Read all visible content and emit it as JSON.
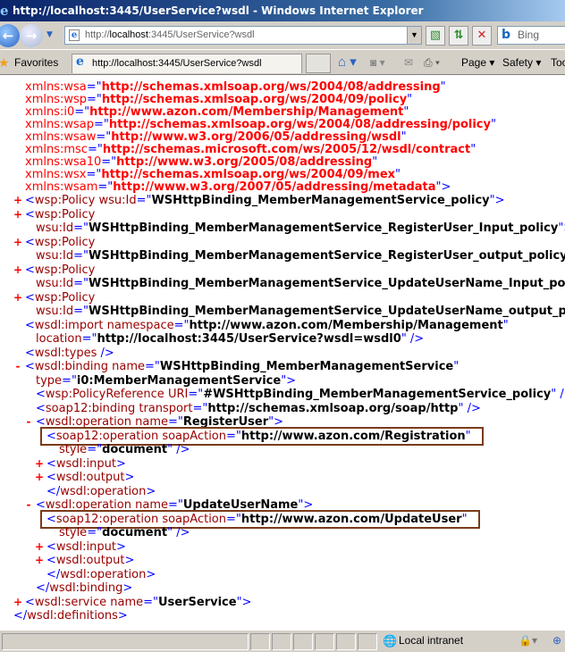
{
  "window": {
    "title": "http://localhost:3445/UserService?wsdl - Windows Internet Explorer"
  },
  "address": {
    "url_prefix": "http://",
    "url_host": "localhost",
    "url_rest": ":3445/UserService?wsdl",
    "search_placeholder": "Bing",
    "back": "←",
    "forward": "→"
  },
  "favorites": {
    "label": "Favorites",
    "tab_title": "http://localhost:3445/UserService?wsdl"
  },
  "commands": {
    "page": "Page ▾",
    "safety": "Safety ▾",
    "tools": "Tools"
  },
  "status": {
    "zone": "Local intranet"
  },
  "colors": {
    "tag": "#990000",
    "bracket": "#0000ff",
    "ns": "#ff0000",
    "box": "#7a3b1a"
  },
  "lines": [
    {
      "lv": 0,
      "tg": "",
      "parts": [
        [
          "na",
          "xmlns:wsa"
        ],
        [
          "q",
          "=\""
        ],
        [
          "nv",
          "http://schemas.xmlsoap.org/ws/2004/08/addressing"
        ],
        [
          "q",
          "\""
        ]
      ]
    },
    {
      "lv": 0,
      "tg": "",
      "parts": [
        [
          "na",
          "xmlns:wsp"
        ],
        [
          "q",
          "=\""
        ],
        [
          "nv",
          "http://schemas.xmlsoap.org/ws/2004/09/policy"
        ],
        [
          "q",
          "\""
        ]
      ]
    },
    {
      "lv": 0,
      "tg": "",
      "parts": [
        [
          "na",
          "xmlns:i0"
        ],
        [
          "q",
          "=\""
        ],
        [
          "nv",
          "http://www.azon.com/Membership/Management"
        ],
        [
          "q",
          "\""
        ]
      ]
    },
    {
      "lv": 0,
      "tg": "",
      "parts": [
        [
          "na",
          "xmlns:wsap"
        ],
        [
          "q",
          "=\""
        ],
        [
          "nv",
          "http://schemas.xmlsoap.org/ws/2004/08/addressing/policy"
        ],
        [
          "q",
          "\""
        ]
      ]
    },
    {
      "lv": 0,
      "tg": "",
      "parts": [
        [
          "na",
          "xmlns:wsaw"
        ],
        [
          "q",
          "=\""
        ],
        [
          "nv",
          "http://www.w3.org/2006/05/addressing/wsdl"
        ],
        [
          "q",
          "\""
        ]
      ]
    },
    {
      "lv": 0,
      "tg": "",
      "parts": [
        [
          "na",
          "xmlns:msc"
        ],
        [
          "q",
          "=\""
        ],
        [
          "nv",
          "http://schemas.microsoft.com/ws/2005/12/wsdl/contract"
        ],
        [
          "q",
          "\""
        ]
      ]
    },
    {
      "lv": 0,
      "tg": "",
      "parts": [
        [
          "na",
          "xmlns:wsa10"
        ],
        [
          "q",
          "=\""
        ],
        [
          "nv",
          "http://www.w3.org/2005/08/addressing"
        ],
        [
          "q",
          "\""
        ]
      ]
    },
    {
      "lv": 0,
      "tg": "",
      "parts": [
        [
          "na",
          "xmlns:wsx"
        ],
        [
          "q",
          "=\""
        ],
        [
          "nv",
          "http://schemas.xmlsoap.org/ws/2004/09/mex"
        ],
        [
          "q",
          "\""
        ]
      ]
    },
    {
      "lv": 0,
      "tg": "",
      "parts": [
        [
          "na",
          "xmlns:wsam"
        ],
        [
          "q",
          "=\""
        ],
        [
          "nv",
          "http://www.w3.org/2007/05/addressing/metadata"
        ],
        [
          "q",
          "\">"
        ]
      ]
    },
    {
      "lv": 0,
      "tg": "+",
      "parts": [
        [
          "b",
          "<"
        ],
        [
          "t",
          "wsp:Policy"
        ],
        [
          "a",
          " wsu:Id"
        ],
        [
          "q",
          "=\""
        ],
        [
          "v",
          "WSHttpBinding_MemberManagementService_policy"
        ],
        [
          "q",
          "\">"
        ]
      ]
    },
    {
      "lv": 0,
      "tg": "+",
      "parts": [
        [
          "b",
          "<"
        ],
        [
          "t",
          "wsp:Policy"
        ]
      ]
    },
    {
      "lv": 1,
      "tg": "",
      "parts": [
        [
          "a",
          "wsu:Id"
        ],
        [
          "q",
          "=\""
        ],
        [
          "v",
          "WSHttpBinding_MemberManagementService_RegisterUser_Input_policy"
        ],
        [
          "q",
          "\">"
        ]
      ]
    },
    {
      "lv": 0,
      "tg": "+",
      "parts": [
        [
          "b",
          "<"
        ],
        [
          "t",
          "wsp:Policy"
        ]
      ]
    },
    {
      "lv": 1,
      "tg": "",
      "parts": [
        [
          "a",
          "wsu:Id"
        ],
        [
          "q",
          "=\""
        ],
        [
          "v",
          "WSHttpBinding_MemberManagementService_RegisterUser_output_policy"
        ],
        [
          "q",
          "\">"
        ]
      ]
    },
    {
      "lv": 0,
      "tg": "+",
      "parts": [
        [
          "b",
          "<"
        ],
        [
          "t",
          "wsp:Policy"
        ]
      ]
    },
    {
      "lv": 1,
      "tg": "",
      "parts": [
        [
          "a",
          "wsu:Id"
        ],
        [
          "q",
          "=\""
        ],
        [
          "v",
          "WSHttpBinding_MemberManagementService_UpdateUserName_Input_policy"
        ],
        [
          "q",
          "\">"
        ]
      ]
    },
    {
      "lv": 0,
      "tg": "+",
      "parts": [
        [
          "b",
          "<"
        ],
        [
          "t",
          "wsp:Policy"
        ]
      ]
    },
    {
      "lv": 1,
      "tg": "",
      "parts": [
        [
          "a",
          "wsu:Id"
        ],
        [
          "q",
          "=\""
        ],
        [
          "v",
          "WSHttpBinding_MemberManagementService_UpdateUserName_output_policy"
        ],
        [
          "q",
          "\">"
        ]
      ]
    },
    {
      "lv": 0,
      "tg": "",
      "parts": [
        [
          "b",
          "<"
        ],
        [
          "t",
          "wsdl:import"
        ],
        [
          "a",
          " namespace"
        ],
        [
          "q",
          "=\""
        ],
        [
          "v",
          "http://www.azon.com/Membership/Management"
        ],
        [
          "q",
          "\""
        ]
      ]
    },
    {
      "lv": 1,
      "tg": "",
      "parts": [
        [
          "a",
          "location"
        ],
        [
          "q",
          "=\""
        ],
        [
          "v",
          "http://localhost:3445/UserService?wsdl=wsdl0"
        ],
        [
          "q",
          "\" />"
        ]
      ]
    },
    {
      "lv": 0,
      "tg": "",
      "parts": [
        [
          "b",
          "<"
        ],
        [
          "t",
          "wsdl:types"
        ],
        [
          "b",
          " />"
        ]
      ]
    },
    {
      "lv": 0,
      "tg": "-",
      "parts": [
        [
          "b",
          "<"
        ],
        [
          "t",
          "wsdl:binding"
        ],
        [
          "a",
          " name"
        ],
        [
          "q",
          "=\""
        ],
        [
          "v",
          "WSHttpBinding_MemberManagementService"
        ],
        [
          "q",
          "\""
        ]
      ]
    },
    {
      "lv": 1,
      "tg": "",
      "parts": [
        [
          "a",
          "type"
        ],
        [
          "q",
          "=\""
        ],
        [
          "v",
          "i0:MemberManagementService"
        ],
        [
          "q",
          "\">"
        ]
      ]
    },
    {
      "lv": 1,
      "tg": "",
      "parts": [
        [
          "b",
          "<"
        ],
        [
          "t",
          "wsp:PolicyReference"
        ],
        [
          "a",
          " URI"
        ],
        [
          "q",
          "=\""
        ],
        [
          "v",
          "#WSHttpBinding_MemberManagementService_policy"
        ],
        [
          "q",
          "\" />"
        ]
      ]
    },
    {
      "lv": 1,
      "tg": "",
      "parts": [
        [
          "b",
          "<"
        ],
        [
          "t",
          "soap12:binding"
        ],
        [
          "a",
          " transport"
        ],
        [
          "q",
          "=\""
        ],
        [
          "v",
          "http://schemas.xmlsoap.org/soap/http"
        ],
        [
          "q",
          "\" />"
        ]
      ]
    },
    {
      "lv": 1,
      "tg": "-",
      "parts": [
        [
          "b",
          "<"
        ],
        [
          "t",
          "wsdl:operation"
        ],
        [
          "a",
          " name"
        ],
        [
          "q",
          "=\""
        ],
        [
          "v",
          "RegisterUser"
        ],
        [
          "q",
          "\">"
        ]
      ]
    },
    {
      "lv": 2,
      "tg": "",
      "box": true,
      "parts": [
        [
          "b",
          "<"
        ],
        [
          "t",
          "soap12:operation"
        ],
        [
          "a",
          " soapAction"
        ],
        [
          "q",
          "=\""
        ],
        [
          "v",
          "http://www.azon.com/Registration"
        ],
        [
          "q",
          "\""
        ]
      ]
    },
    {
      "lv": 3,
      "tg": "",
      "parts": [
        [
          "a",
          "style"
        ],
        [
          "q",
          "=\""
        ],
        [
          "v",
          "document"
        ],
        [
          "q",
          "\" />"
        ]
      ]
    },
    {
      "lv": 2,
      "tg": "+",
      "parts": [
        [
          "b",
          "<"
        ],
        [
          "t",
          "wsdl:input"
        ],
        [
          "b",
          ">"
        ]
      ]
    },
    {
      "lv": 2,
      "tg": "+",
      "parts": [
        [
          "b",
          "<"
        ],
        [
          "t",
          "wsdl:output"
        ],
        [
          "b",
          ">"
        ]
      ]
    },
    {
      "lv": 2,
      "tg": "",
      "parts": [
        [
          "b",
          "</"
        ],
        [
          "t",
          "wsdl:operation"
        ],
        [
          "b",
          ">"
        ]
      ]
    },
    {
      "lv": 1,
      "tg": "-",
      "parts": [
        [
          "b",
          "<"
        ],
        [
          "t",
          "wsdl:operation"
        ],
        [
          "a",
          " name"
        ],
        [
          "q",
          "=\""
        ],
        [
          "v",
          "UpdateUserName"
        ],
        [
          "q",
          "\">"
        ]
      ]
    },
    {
      "lv": 2,
      "tg": "",
      "box": true,
      "parts": [
        [
          "b",
          "<"
        ],
        [
          "t",
          "soap12:operation"
        ],
        [
          "a",
          " soapAction"
        ],
        [
          "q",
          "=\""
        ],
        [
          "v",
          "http://www.azon.com/UpdateUser"
        ],
        [
          "q",
          "\""
        ]
      ]
    },
    {
      "lv": 3,
      "tg": "",
      "parts": [
        [
          "a",
          "style"
        ],
        [
          "q",
          "=\""
        ],
        [
          "v",
          "document"
        ],
        [
          "q",
          "\" />"
        ]
      ]
    },
    {
      "lv": 2,
      "tg": "+",
      "parts": [
        [
          "b",
          "<"
        ],
        [
          "t",
          "wsdl:input"
        ],
        [
          "b",
          ">"
        ]
      ]
    },
    {
      "lv": 2,
      "tg": "+",
      "parts": [
        [
          "b",
          "<"
        ],
        [
          "t",
          "wsdl:output"
        ],
        [
          "b",
          ">"
        ]
      ]
    },
    {
      "lv": 2,
      "tg": "",
      "parts": [
        [
          "b",
          "</"
        ],
        [
          "t",
          "wsdl:operation"
        ],
        [
          "b",
          ">"
        ]
      ]
    },
    {
      "lv": 1,
      "tg": "",
      "parts": [
        [
          "b",
          "</"
        ],
        [
          "t",
          "wsdl:binding"
        ],
        [
          "b",
          ">"
        ]
      ]
    },
    {
      "lv": 0,
      "tg": "+",
      "parts": [
        [
          "b",
          "<"
        ],
        [
          "t",
          "wsdl:service"
        ],
        [
          "a",
          " name"
        ],
        [
          "q",
          "=\""
        ],
        [
          "v",
          "UserService"
        ],
        [
          "q",
          "\">"
        ]
      ]
    },
    {
      "lv": -1,
      "tg": "",
      "parts": [
        [
          "b",
          "</"
        ],
        [
          "t",
          "wsdl:definitions"
        ],
        [
          "b",
          ">"
        ]
      ]
    }
  ]
}
